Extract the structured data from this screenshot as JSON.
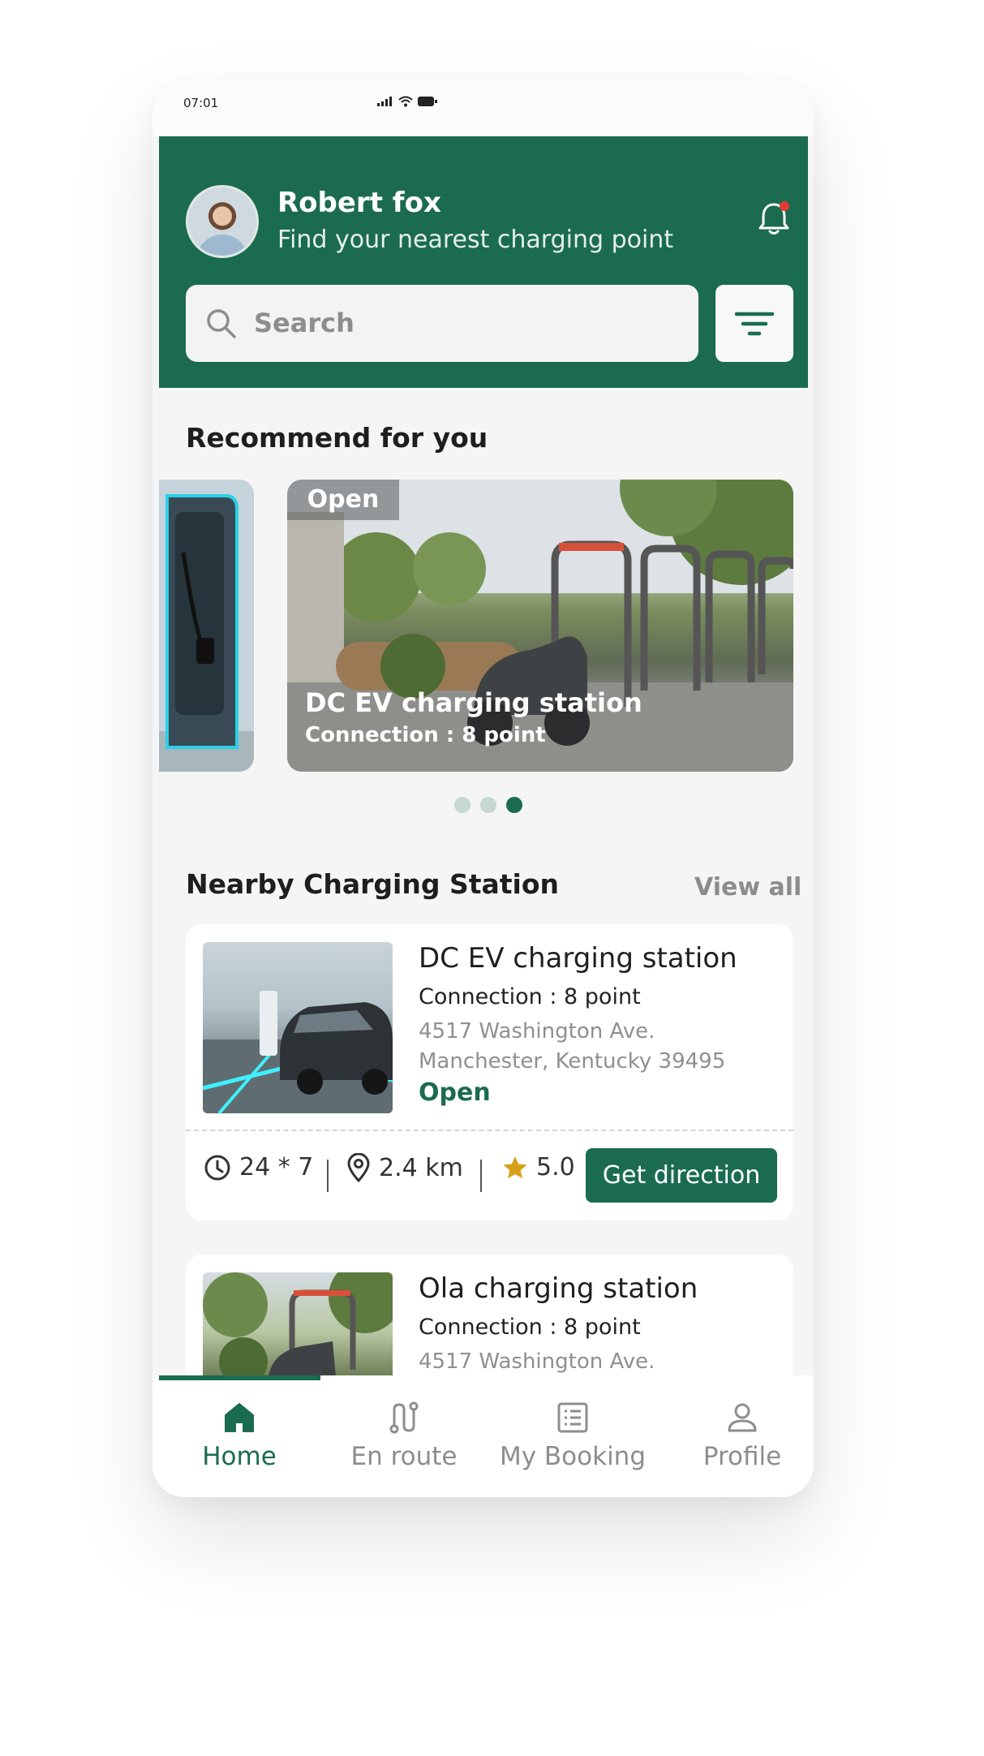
{
  "status_bar": {
    "time": "07:01"
  },
  "header": {
    "user_name": "Robert fox",
    "subtitle": "Find your nearest charging point",
    "search_placeholder": "Search"
  },
  "recommend": {
    "title": "Recommend for you",
    "cards": [
      {
        "badge": "Open",
        "title": "DC EV charging station",
        "subtitle": "Connection : 8 point"
      }
    ],
    "carousel_active_index": 3,
    "carousel_total": 3
  },
  "nearby": {
    "title": "Nearby Charging Station",
    "view_all": "View all",
    "stations": [
      {
        "name": "DC EV charging station",
        "connection": "Connection : 8 point",
        "address_line1": "4517 Washington Ave.",
        "address_line2": "Manchester, Kentucky 39495",
        "status": "Open",
        "hours": "24 * 7",
        "distance": "2.4 km",
        "rating": "5.0",
        "action": "Get direction"
      },
      {
        "name": "Ola charging station",
        "connection": "Connection : 8 point",
        "address_line1": "4517 Washington Ave."
      }
    ]
  },
  "bottom_nav": {
    "items": [
      {
        "label": "Home",
        "icon": "home-icon",
        "active": true
      },
      {
        "label": "En route",
        "icon": "route-icon",
        "active": false
      },
      {
        "label": "My Booking",
        "icon": "booking-icon",
        "active": false
      },
      {
        "label": "Profile",
        "icon": "profile-icon",
        "active": false
      }
    ]
  },
  "colors": {
    "brand": "#1b6b51",
    "notification_dot": "#e53935",
    "star": "#d9a11a"
  }
}
